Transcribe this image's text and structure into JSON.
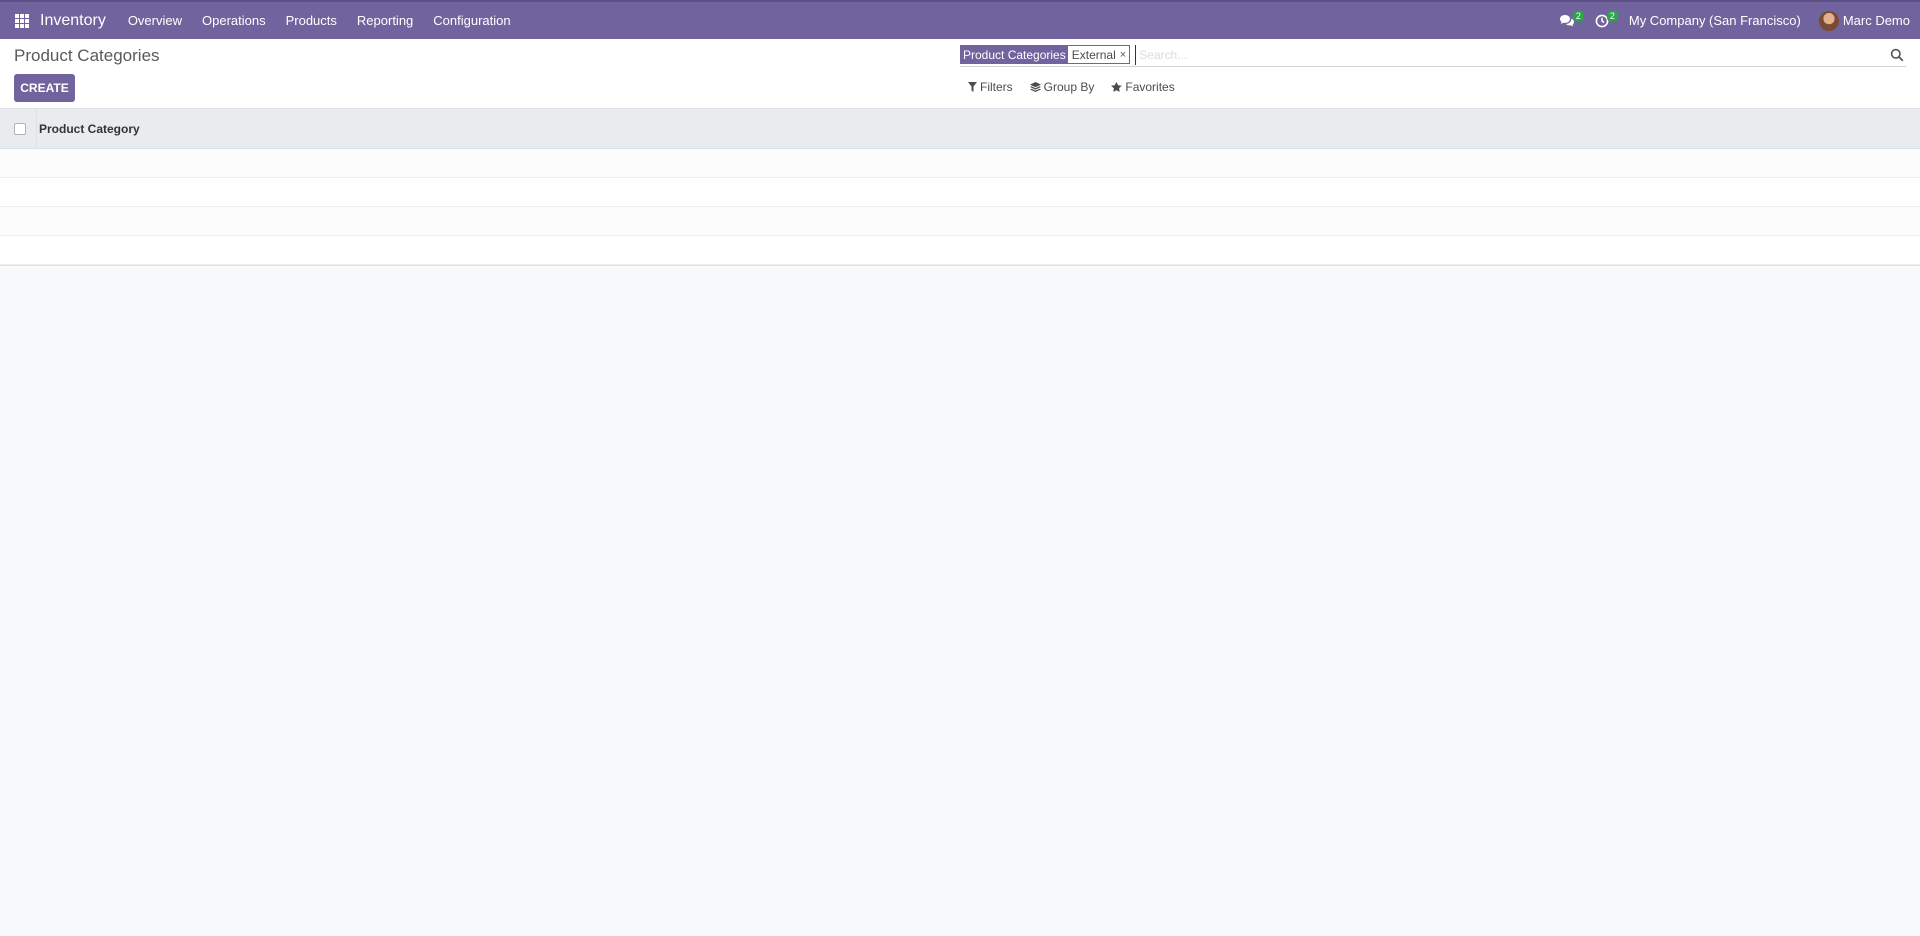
{
  "navbar": {
    "app_name": "Inventory",
    "menu": [
      {
        "label": "Overview"
      },
      {
        "label": "Operations"
      },
      {
        "label": "Products"
      },
      {
        "label": "Reporting"
      },
      {
        "label": "Configuration"
      }
    ],
    "messages_count": "2",
    "activities_count": "2",
    "company": "My Company (San Francisco)",
    "user_name": "Marc Demo"
  },
  "control_panel": {
    "breadcrumb": "Product Categories",
    "create_label": "Create",
    "search": {
      "facet_label": "Product Categories",
      "facet_value": "External",
      "facet_remove": "×",
      "placeholder": "Search..."
    },
    "filters_label": "Filters",
    "groupby_label": "Group By",
    "favorites_label": "Favorites"
  },
  "list": {
    "column_header": "Product Category",
    "empty_rows": 4
  },
  "colors": {
    "brand": "#71639e",
    "badge": "#28a745",
    "background": "#f8f9fa"
  }
}
